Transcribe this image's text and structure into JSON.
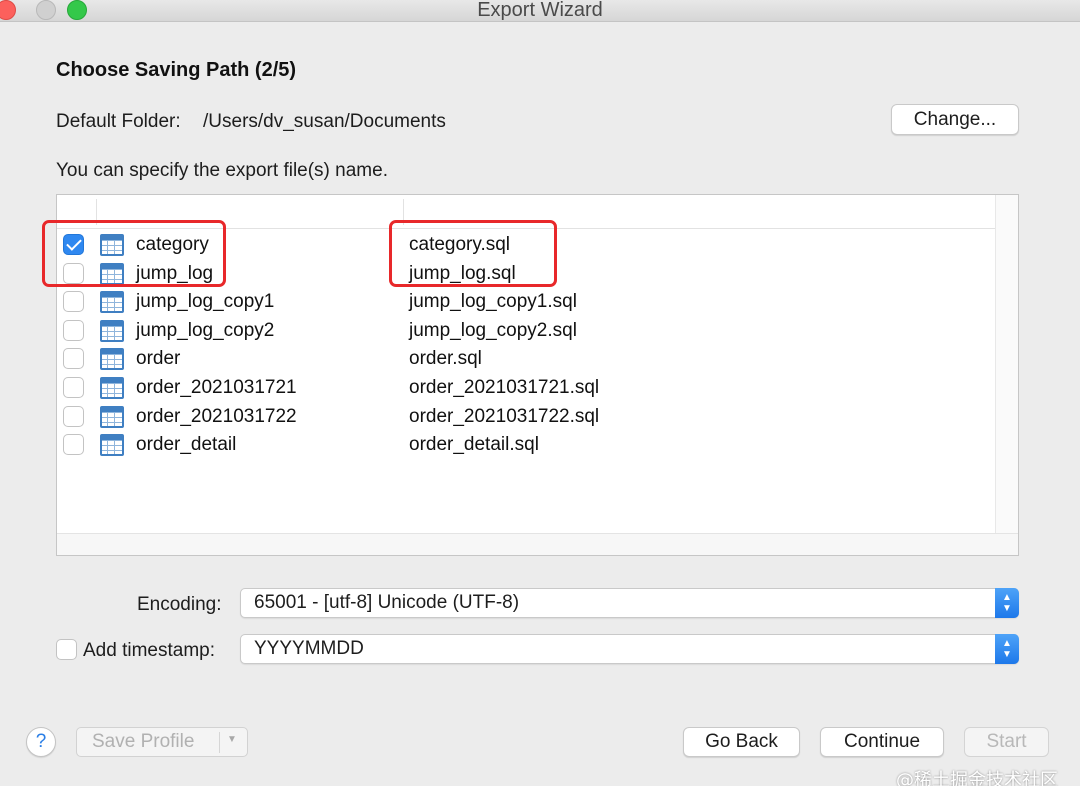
{
  "window": {
    "title": "Export Wizard"
  },
  "header": {
    "step_title": "Choose Saving Path (2/5)"
  },
  "folder": {
    "label": "Default Folder:",
    "path": "/Users/dv_susan/Documents",
    "change_label": "Change..."
  },
  "hint": "You can specify the export file(s) name.",
  "tables": [
    {
      "name": "category",
      "file": "category.sql",
      "checked": true
    },
    {
      "name": "jump_log",
      "file": "jump_log.sql",
      "checked": false
    },
    {
      "name": "jump_log_copy1",
      "file": "jump_log_copy1.sql",
      "checked": false
    },
    {
      "name": "jump_log_copy2",
      "file": "jump_log_copy2.sql",
      "checked": false
    },
    {
      "name": "order",
      "file": "order.sql",
      "checked": false
    },
    {
      "name": "order_2021031721",
      "file": "order_2021031721.sql",
      "checked": false
    },
    {
      "name": "order_2021031722",
      "file": "order_2021031722.sql",
      "checked": false
    },
    {
      "name": "order_detail",
      "file": "order_detail.sql",
      "checked": false
    }
  ],
  "encoding": {
    "label": "Encoding:",
    "value": "65001 - [utf-8] Unicode (UTF-8)"
  },
  "timestamp": {
    "label": "Add timestamp:",
    "value": "YYYYMMDD",
    "checked": false
  },
  "footer": {
    "help_label": "?",
    "save_profile_label": "Save Profile",
    "go_back_label": "Go Back",
    "continue_label": "Continue",
    "start_label": "Start"
  },
  "watermark": "@稀土掘金技术社区",
  "colors": {
    "accent": "#2f88f0",
    "highlight": "#e8282a"
  }
}
